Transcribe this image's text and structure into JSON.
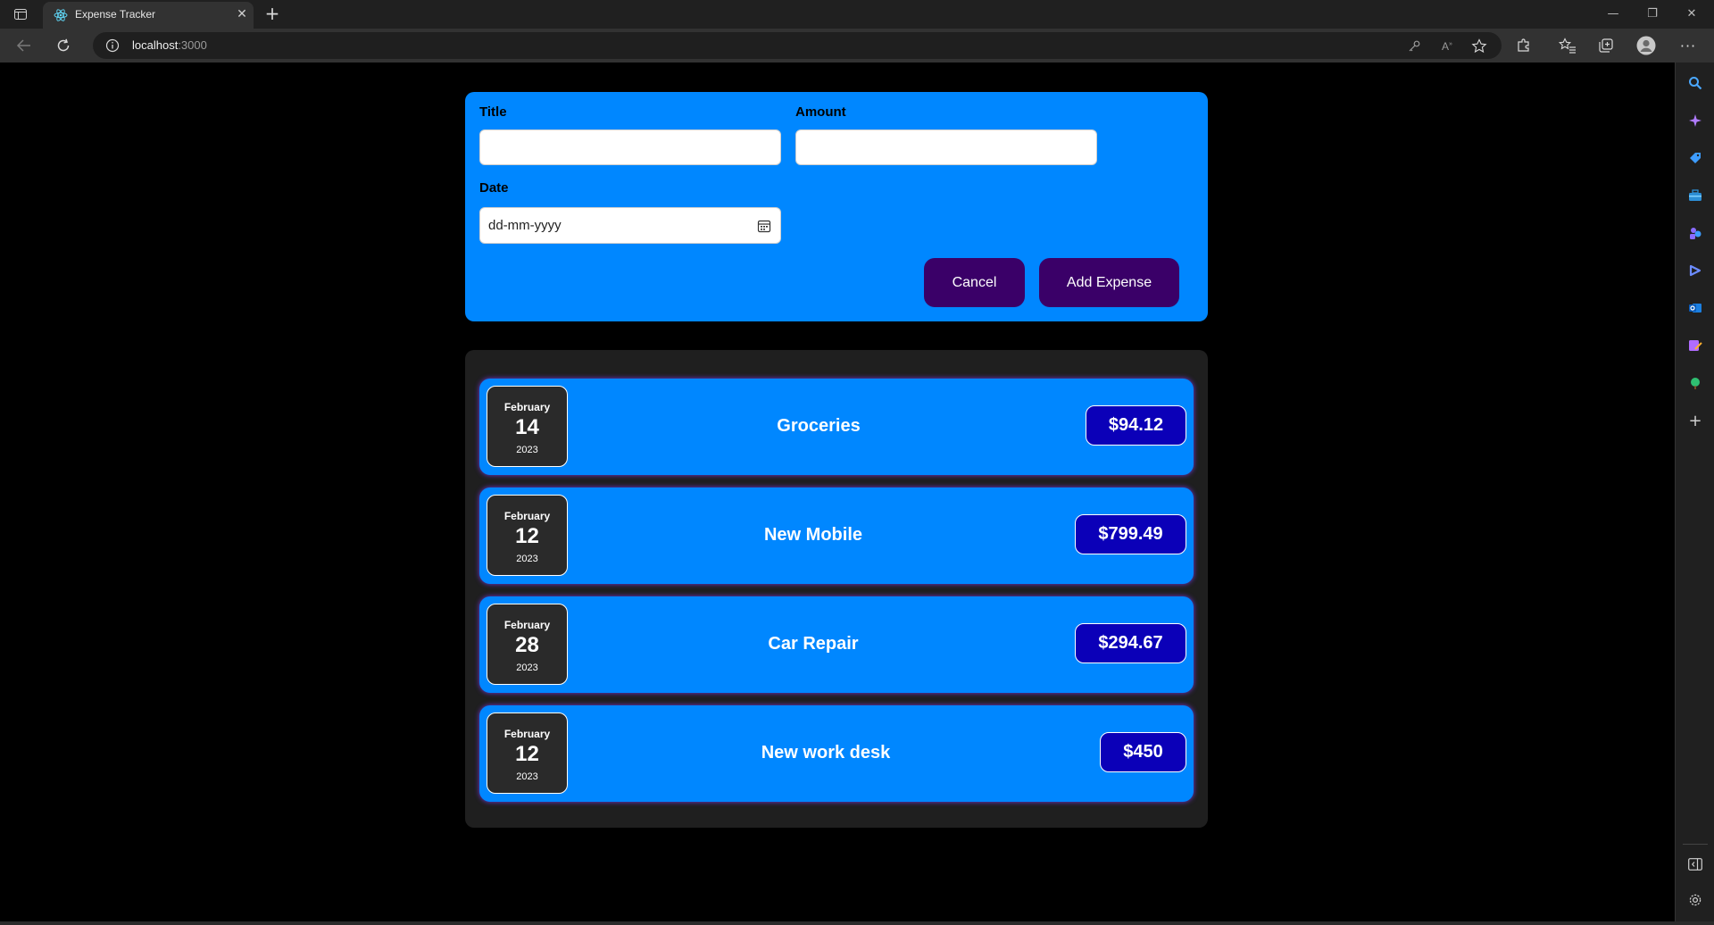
{
  "browser": {
    "tab_title": "Expense Tracker",
    "url_host": "localhost",
    "url_port": ":3000"
  },
  "form": {
    "title_label": "Title",
    "amount_label": "Amount",
    "date_label": "Date",
    "date_placeholder": "dd-mm-yyyy",
    "title_value": "",
    "amount_value": "",
    "cancel_label": "Cancel",
    "add_label": "Add Expense"
  },
  "expenses": [
    {
      "month": "February",
      "day": "14",
      "year": "2023",
      "title": "Groceries",
      "amount": "$94.12"
    },
    {
      "month": "February",
      "day": "12",
      "year": "2023",
      "title": "New Mobile",
      "amount": "$799.49"
    },
    {
      "month": "February",
      "day": "28",
      "year": "2023",
      "title": "Car Repair",
      "amount": "$294.67"
    },
    {
      "month": "February",
      "day": "12",
      "year": "2023",
      "title": "New work desk",
      "amount": "$450"
    }
  ],
  "colors": {
    "card_blue": "#0087ff",
    "button_purple": "#3a0068",
    "amount_navy": "#0b00b8",
    "list_bg": "#1f1f1f"
  }
}
